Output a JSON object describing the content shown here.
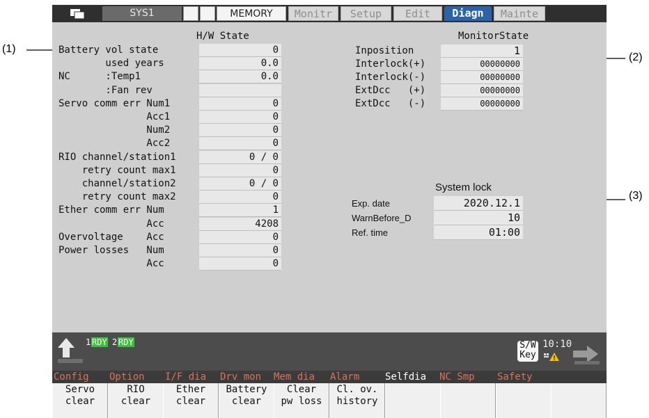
{
  "callouts": [
    "(1)",
    "(2)",
    "(3)"
  ],
  "tabs": {
    "sys": "SYS1",
    "mode": "MEMORY",
    "items": [
      "Monitr",
      "Setup",
      "Edit",
      "Diagn",
      "Mainte"
    ],
    "active": "Diagn"
  },
  "hw": {
    "header": "H/W State",
    "rows": [
      {
        "label": "Battery vol state",
        "value": "0"
      },
      {
        "label": "        used years",
        "value": "0.0"
      },
      {
        "label": "NC      :Temp1",
        "value": "0.0"
      },
      {
        "label": "        :Fan rev",
        "value": ""
      },
      {
        "label": "Servo comm err Num1",
        "value": "0"
      },
      {
        "label": "               Acc1",
        "value": "0"
      },
      {
        "label": "               Num2",
        "value": "0"
      },
      {
        "label": "               Acc2",
        "value": "0"
      },
      {
        "label": "RIO channel/station1",
        "value": "0 / 0"
      },
      {
        "label": "    retry count max1",
        "value": "0"
      },
      {
        "label": "    channel/station2",
        "value": "0 / 0"
      },
      {
        "label": "    retry count max2",
        "value": "0"
      },
      {
        "label": "Ether comm err Num",
        "value": "1"
      },
      {
        "label": "               Acc",
        "value": "4208"
      },
      {
        "label": "Overvoltage    Acc",
        "value": "0"
      },
      {
        "label": "Power losses   Num",
        "value": "0"
      },
      {
        "label": "               Acc",
        "value": "0"
      }
    ]
  },
  "monitor": {
    "header": "MonitorState",
    "rows": [
      {
        "label": "Inposition",
        "value": "1"
      },
      {
        "label": "Interlock(+)",
        "value": "00000000"
      },
      {
        "label": "Interlock(-)",
        "value": "00000000"
      },
      {
        "label": "ExtDcc   (+)",
        "value": "00000000"
      },
      {
        "label": "ExtDcc   (-)",
        "value": "00000000"
      }
    ]
  },
  "syslock": {
    "header": "System lock",
    "rows": [
      {
        "label": "Exp. date",
        "value": "2020.12.1"
      },
      {
        "label": "WarnBefore_D",
        "value": "10"
      },
      {
        "label": "Ref. time",
        "value": "01:00"
      }
    ]
  },
  "status": {
    "rdy1_num": "1",
    "rdy1": "RDY",
    "rdy2_num": "2",
    "rdy2": "RDY",
    "sw_key_top": "S/W",
    "sw_key_bottom": "Key",
    "time": "10:10"
  },
  "menu": [
    "Config",
    "Option",
    "I/F dia",
    "Drv mon",
    "Mem dia",
    "Alarm",
    "Selfdia",
    "NC Smp",
    "Safety"
  ],
  "menu_active": "Selfdia",
  "softkeys": [
    {
      "top": "Servo",
      "bottom": "clear"
    },
    {
      "top": "RIO",
      "bottom": "clear"
    },
    {
      "top": "Ether",
      "bottom": "clear"
    },
    {
      "top": "Battery",
      "bottom": "clear"
    },
    {
      "top": "Clear",
      "bottom": "pw loss"
    },
    {
      "top": "Cl. ov.",
      "bottom": "history"
    },
    {
      "top": "",
      "bottom": ""
    },
    {
      "top": "",
      "bottom": ""
    },
    {
      "top": "",
      "bottom": ""
    },
    {
      "top": "",
      "bottom": ""
    }
  ],
  "colors": {
    "active_tab": "#2c63a8",
    "ready_bg": "#3fbf3f",
    "menu_text": "#d9735a",
    "panel_bg": "#cfcfcf"
  }
}
